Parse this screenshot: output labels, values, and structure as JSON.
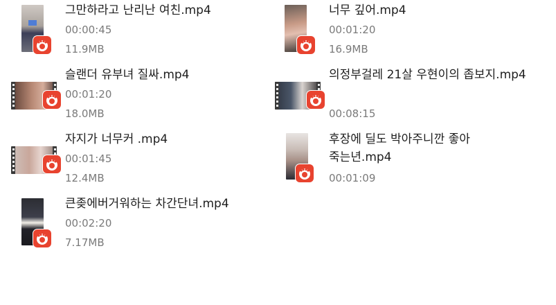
{
  "files": [
    {
      "name": "그만하라고 난리난 여친.mp4",
      "duration": "00:00:45",
      "size": "11.9MB",
      "icon": "video-file-icon"
    },
    {
      "name": "너무 깊어.mp4",
      "duration": "00:01:20",
      "size": "16.9MB",
      "icon": "video-file-icon"
    },
    {
      "name": "슬랜더 유부녀 질싸.mp4",
      "duration": "00:01:20",
      "size": "18.0MB",
      "icon": "video-file-icon"
    },
    {
      "name": "의정부걸레 21살 우현이의 좁보지.mp4",
      "duration": "00:08:15",
      "size": "",
      "icon": "video-file-icon"
    },
    {
      "name": "자지가 너무커 .mp4",
      "duration": "00:01:45",
      "size": "12.4MB",
      "icon": "video-file-icon"
    },
    {
      "name": "후장에 딜도 박아주니깐 좋아 죽는년.mp4",
      "duration": "00:01:09",
      "size": "",
      "icon": "video-file-icon"
    },
    {
      "name": "큰좆에버거워하는 차간단녀.mp4",
      "duration": "00:02:20",
      "size": "7.17MB",
      "icon": "video-file-icon"
    }
  ],
  "colors": {
    "badge": "#e8432f",
    "name_text": "#1e1e1e",
    "meta_text": "#7a7a7a"
  }
}
